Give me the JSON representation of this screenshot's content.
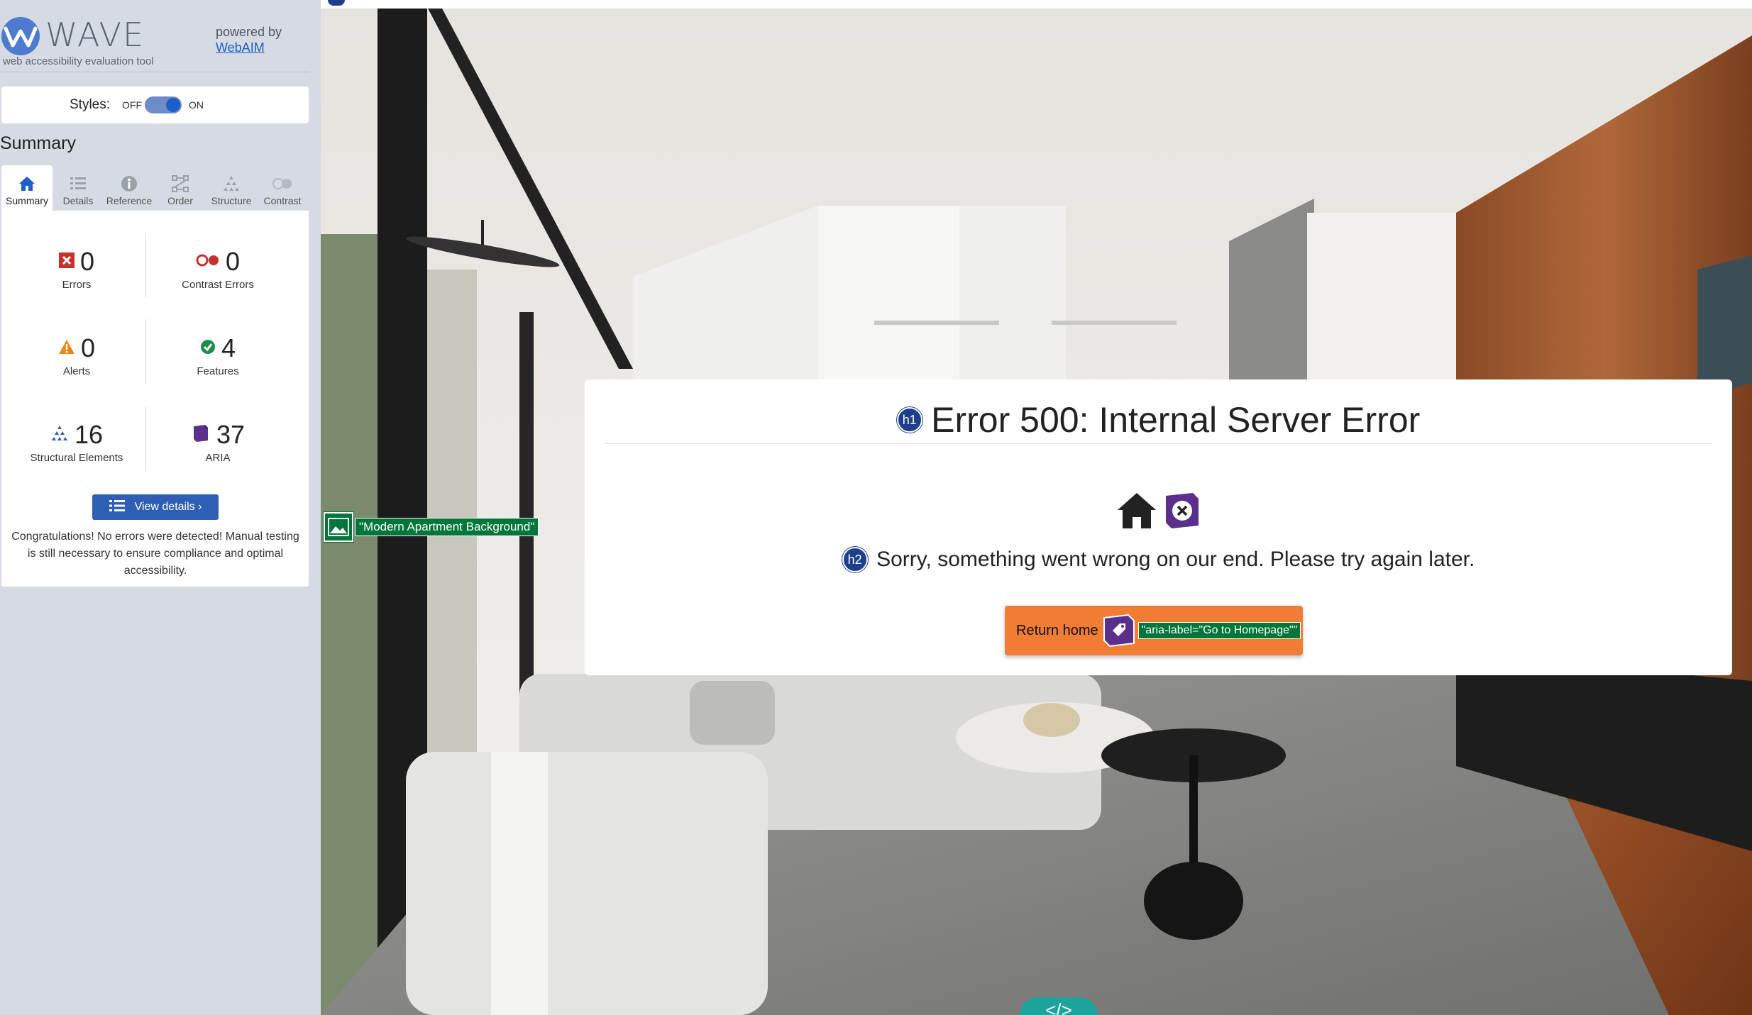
{
  "wave": {
    "logo_text": "WAVE",
    "logo_subtitle": "web accessibility evaluation tool",
    "powered_by": "powered by",
    "webaim_link": "WebAIM",
    "styles_label": "Styles:",
    "styles_off": "OFF",
    "styles_on": "ON",
    "styles_state": "on",
    "summary_title": "Summary",
    "tabs": [
      {
        "label": "Summary",
        "icon": "home-icon",
        "active": true
      },
      {
        "label": "Details",
        "icon": "list-icon",
        "active": false
      },
      {
        "label": "Reference",
        "icon": "info-icon",
        "active": false
      },
      {
        "label": "Order",
        "icon": "order-icon",
        "active": false
      },
      {
        "label": "Structure",
        "icon": "structure-icon",
        "active": false
      },
      {
        "label": "Contrast",
        "icon": "contrast-icon",
        "active": false
      }
    ],
    "stats": {
      "errors": {
        "value": "0",
        "label": "Errors",
        "color": "#c8312b"
      },
      "contrast_errors": {
        "value": "0",
        "label": "Contrast Errors",
        "color": "#c8312b"
      },
      "alerts": {
        "value": "0",
        "label": "Alerts",
        "color": "#e88a1a"
      },
      "features": {
        "value": "4",
        "label": "Features",
        "color": "#1e8b4f"
      },
      "structural": {
        "value": "16",
        "label": "Structural Elements",
        "color": "#2f5fb5"
      },
      "aria": {
        "value": "37",
        "label": "ARIA",
        "color": "#5b2f8c"
      }
    },
    "view_details": "View details ›",
    "congrats": "Congratulations! No errors were detected! Manual testing is still necessary to ensure compliance and optimal accessibility."
  },
  "page": {
    "h1_badge": "h1",
    "h1_text": "Error 500: Internal Server Error",
    "h2_badge": "h2",
    "h2_text": "Sorry, something went wrong on our end. Please try again later.",
    "return_button": "Return home",
    "aria_label_tag": "\"aria-label=\"Go to Homepage\"\"",
    "alt_text_tag": "\"Modern Apartment Background\"",
    "code_tab": "</>"
  },
  "colors": {
    "accent_blue": "#1d5ec9",
    "badge_navy": "#1d3f8c",
    "button_orange": "#f07d33",
    "wave_green": "#00763a",
    "aria_purple": "#5b2f8c"
  }
}
